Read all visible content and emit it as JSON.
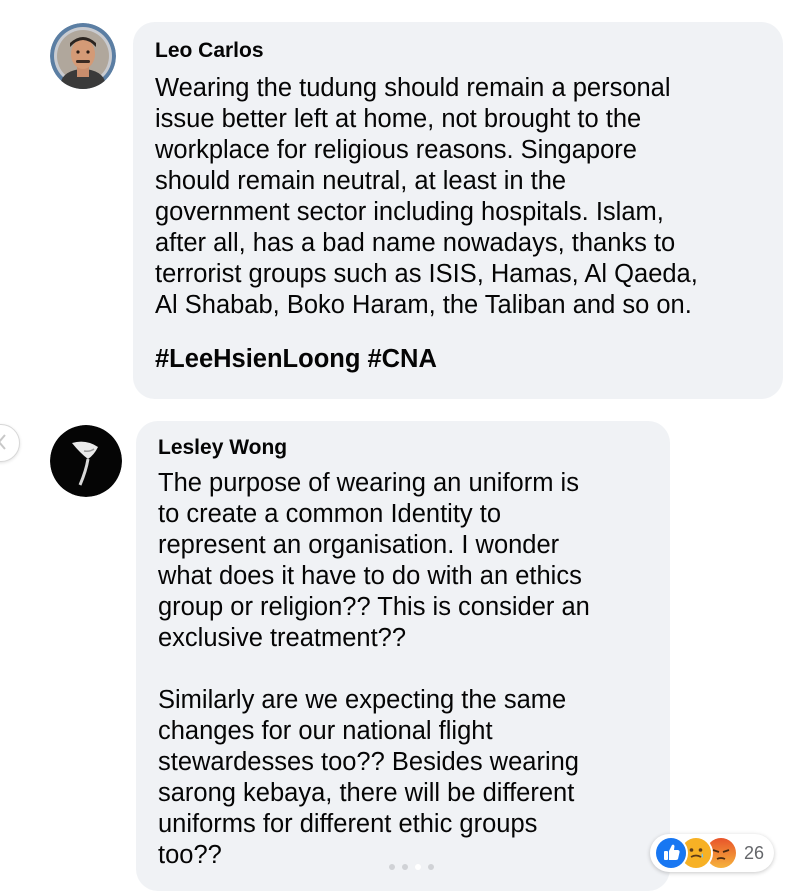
{
  "comments": [
    {
      "author": "Leo Carlos",
      "text": "Wearing the tudung should remain a personal\nissue better left at home, not brought to the\nworkplace for religious reasons. Singapore\nshould remain neutral, at least in the\ngovernment sector including hospitals. Islam,\nafter all, has a bad name nowadays, thanks to\nterrorist groups such as ISIS, Hamas, Al Qaeda,\nAl Shabab, Boko Haram, the Taliban and so on.",
      "hashtags": [
        "#LeeHsienLoong",
        "#CNA"
      ],
      "avatar_icon": "user-photo-icon"
    },
    {
      "author": "Lesley Wong",
      "paragraphs": [
        "The purpose of wearing an uniform is\nto create a common Identity to\nrepresent an organisation. I wonder\nwhat does it have to do with an ethics\ngroup or religion?? This is consider an\nexclusive treatment??",
        "Similarly are we expecting the same\nchanges for our national flight\nstewardesses too?? Besides wearing\nsarong kebaya, there will be different\nuniforms for different ethic groups\ntoo??"
      ],
      "avatar_icon": "calla-lily-photo-icon",
      "reactions": {
        "icons": [
          "like-icon",
          "care-icon",
          "angry-icon"
        ],
        "count": "26"
      }
    }
  ],
  "navigation": {
    "prev_icon": "chevron-left-icon",
    "dots_total": 4,
    "active_dot": 3
  },
  "colors": {
    "bubble_bg": "#f0f2f5",
    "text": "#050505",
    "like_blue": "#1877f2",
    "angry_orange": "#e8542a",
    "care_yellow": "#f7b125",
    "count_gray": "#65676b"
  }
}
